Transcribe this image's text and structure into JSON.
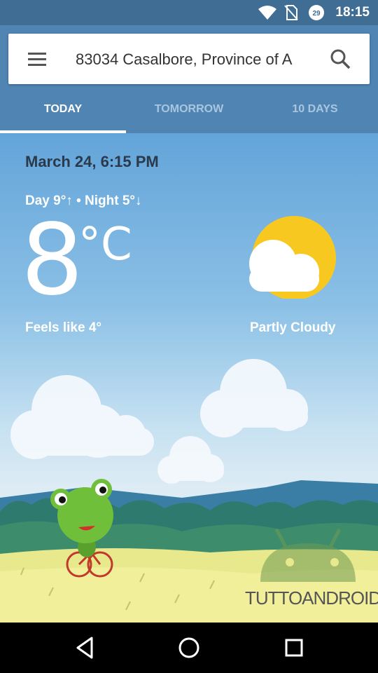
{
  "status_bar": {
    "time": "18:15",
    "battery_level": "29"
  },
  "header": {
    "location": "83034 Casalbore, Province of A",
    "menu_icon": "menu-icon",
    "search_icon": "search-icon"
  },
  "tabs": [
    {
      "label": "TODAY",
      "active": true
    },
    {
      "label": "TOMORROW",
      "active": false
    },
    {
      "label": "10 DAYS",
      "active": false
    }
  ],
  "weather": {
    "date_time": "March 24, 6:15 PM",
    "day_night": "Day 9°↑ • Night 5°↓",
    "temperature": "8",
    "unit": "°C",
    "feels_like": "Feels like 4°",
    "condition": "Partly Cloudy",
    "condition_icon": "partly-cloudy-icon"
  },
  "watermark": {
    "text": "TUTTOANDROID"
  },
  "nav_bar": {
    "back_icon": "back-icon",
    "home_icon": "home-icon",
    "recents_icon": "recents-icon"
  },
  "colors": {
    "header": "#4f84b3",
    "status_bar": "#3f6d94",
    "sky_top": "#63a4d9",
    "sun": "#f7c920"
  }
}
